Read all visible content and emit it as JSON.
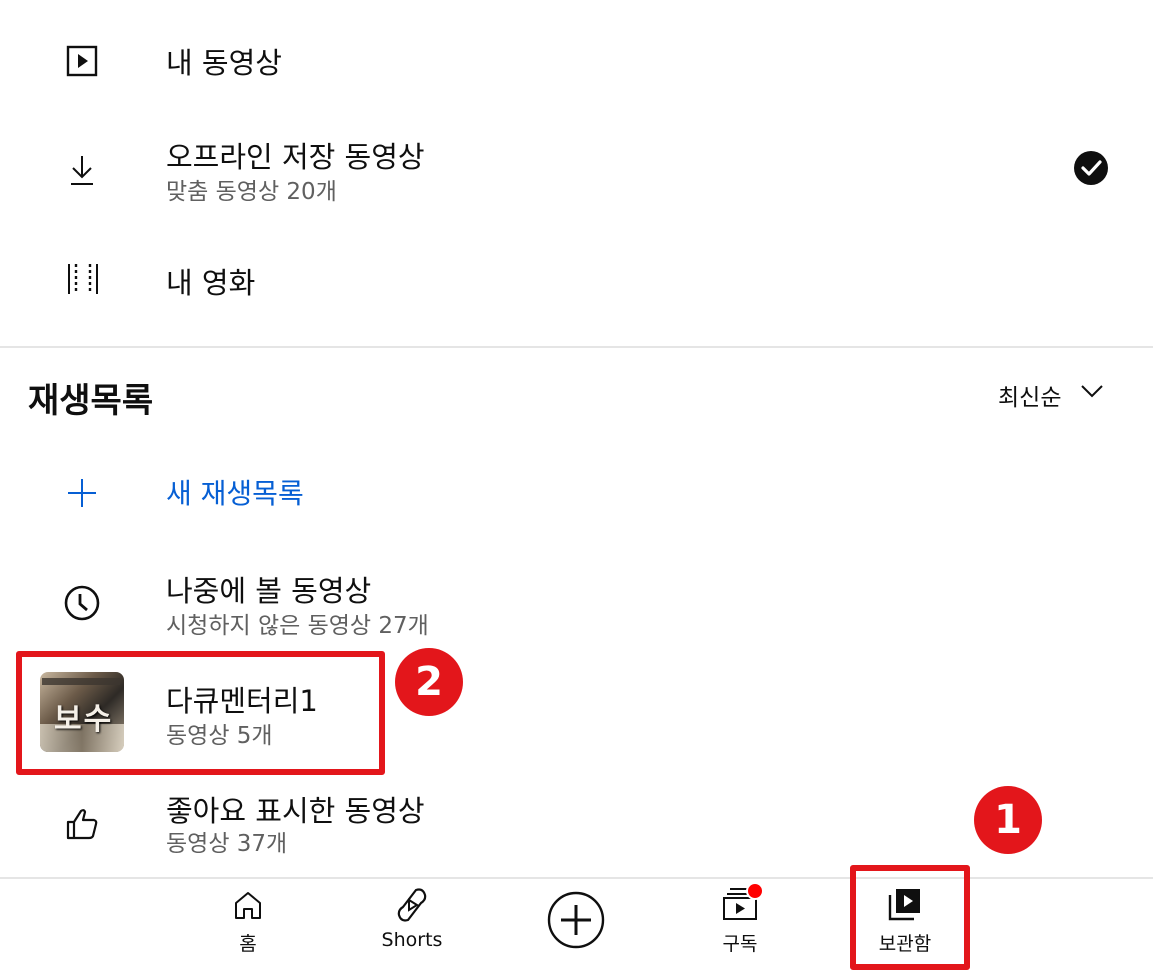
{
  "menu": {
    "my_videos": {
      "title": "내 동영상",
      "icon": "play-square-icon"
    },
    "offline": {
      "title": "오프라인 저장 동영상",
      "subtitle": "맞춤 동영상 20개",
      "icon": "download-icon",
      "status_icon": "check-circle-icon"
    },
    "my_movies": {
      "title": "내 영화",
      "icon": "film-icon"
    }
  },
  "playlists": {
    "header": "재생목록",
    "sort_label": "최신순",
    "new_playlist": "새 재생목록",
    "items": [
      {
        "title": "나중에 볼 동영상",
        "subtitle": "시청하지 않은 동영상 27개",
        "icon": "clock-icon"
      },
      {
        "title": "다큐멘터리1",
        "subtitle": "동영상 5개",
        "thumbnail_text": "보수"
      },
      {
        "title": "좋아요 표시한 동영상",
        "subtitle": "동영상 37개",
        "icon": "thumbs-up-icon"
      }
    ]
  },
  "annotations": {
    "badge_1": "1",
    "badge_2": "2",
    "highlight_color": "#e3161b"
  },
  "bottom_nav": {
    "items": [
      {
        "label": "홈",
        "icon": "home-icon"
      },
      {
        "label": "Shorts",
        "icon": "shorts-icon"
      },
      {
        "label": "",
        "icon": "create-plus-icon"
      },
      {
        "label": "구독",
        "icon": "subscriptions-icon",
        "notification_dot": true
      },
      {
        "label": "보관함",
        "icon": "library-icon",
        "active": true
      }
    ]
  },
  "colors": {
    "accent_blue": "#065fd4",
    "text_primary": "#0f0f0f",
    "text_secondary": "#606060",
    "notification": "#ff0000"
  }
}
